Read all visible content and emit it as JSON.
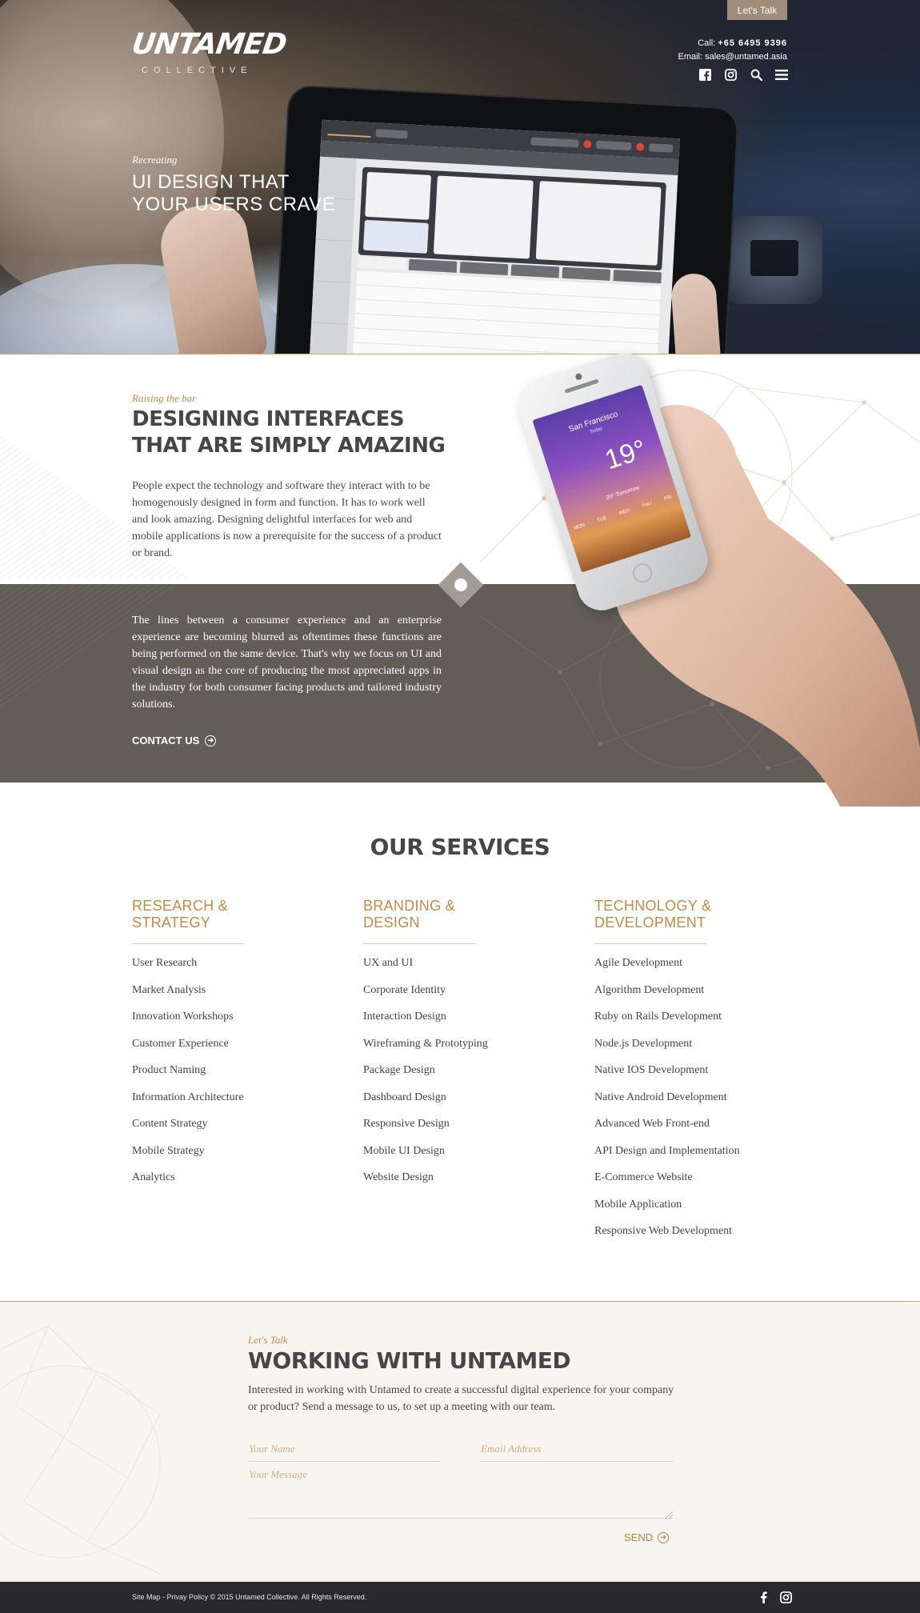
{
  "header": {
    "logo_main": "UNTAMED",
    "logo_sub": "COLLECTIVE",
    "lets_talk_label": "Let's Talk",
    "call_label": "Call:",
    "phone": "+65 6495 9396",
    "email_label": "Email:",
    "email": "sales@untamed.asia",
    "icons": [
      "facebook-icon",
      "instagram-icon",
      "search-icon",
      "menu-icon"
    ]
  },
  "hero": {
    "kicker": "Recreating",
    "title_line1": "UI DESIGN THAT",
    "title_line2": "YOUR USERS CRAVE"
  },
  "design": {
    "kicker": "Raising the bar",
    "title_line1": "DESIGNING INTERFACES",
    "title_line2": "THAT ARE SIMPLY AMAZING",
    "paragraph1": "People expect the technology and software they interact with to be homogenously designed in form and function. It has to work well and look amazing. Designing delightful interfaces for web and mobile applications is now a prerequisite for the success of a product or brand.",
    "paragraph2": "The lines between a consumer experience and an enterprise experience are becoming blurred as oftentimes these functions are being performed on the same device. That's why we focus on UI and visual design as the core of producing the most appreciated apps in the industry for both consumer facing products and tailored industry solutions.",
    "cta_label": "CONTACT US"
  },
  "phone_app": {
    "city": "San Francisco",
    "day": "Today",
    "temp": "19°",
    "tomorrow": "20° Tomorrow",
    "days": [
      "MON",
      "TUE",
      "WED",
      "THU",
      "FRI"
    ]
  },
  "services": {
    "title": "OUR SERVICES",
    "columns": [
      {
        "heading_line1": "RESEARCH &",
        "heading_line2": "STRATEGY",
        "items": [
          "User Research",
          "Market Analysis",
          "Innovation Workshops",
          "Customer Experience",
          "Product Naming",
          "Information Architecture",
          "Content Strategy",
          "Mobile Strategy",
          "Analytics"
        ]
      },
      {
        "heading_line1": "BRANDING &",
        "heading_line2": "DESIGN",
        "items": [
          "UX and UI",
          "Corporate Identity",
          "Interaction Design",
          "Wireframing & Prototyping",
          "Package Design",
          "Dashboard Design",
          "Responsive Design",
          "Mobile UI Design",
          "Website Design"
        ]
      },
      {
        "heading_line1": "TECHNOLOGY &",
        "heading_line2": "DEVELOPMENT",
        "items": [
          "Agile Development",
          "Algorithm Development",
          "Ruby on Rails Development",
          "Node.js Development",
          "Native IOS Development",
          "Native Android Development",
          "Advanced Web Front-end",
          "API Design and Implementation",
          "E-Commerce Website",
          "Mobile Application",
          "Responsive Web Development"
        ]
      }
    ]
  },
  "contact": {
    "kicker": "Let's Talk",
    "title": "WORKING WITH UNTAMED",
    "intro": "Interested in working with Untamed to create a successful digital experience for your company or product? Send a message to us, to set up a meeting with our team.",
    "name_placeholder": "Your Name",
    "email_placeholder": "Email Address",
    "message_placeholder": "Your Message",
    "send_label": "SEND"
  },
  "footer": {
    "text": "Site Map - Privay Policy © 2015 Untamed Collective. All Rights Reserved.",
    "icons": [
      "facebook-icon",
      "instagram-icon"
    ]
  },
  "colors": {
    "accent_gold": "#c08b4a",
    "dark_band": "#625d57",
    "heading": "#474548",
    "contact_bg": "#f8f5f0",
    "footer_bg": "#29292b",
    "lets_talk_bg": "#a08c7b"
  }
}
